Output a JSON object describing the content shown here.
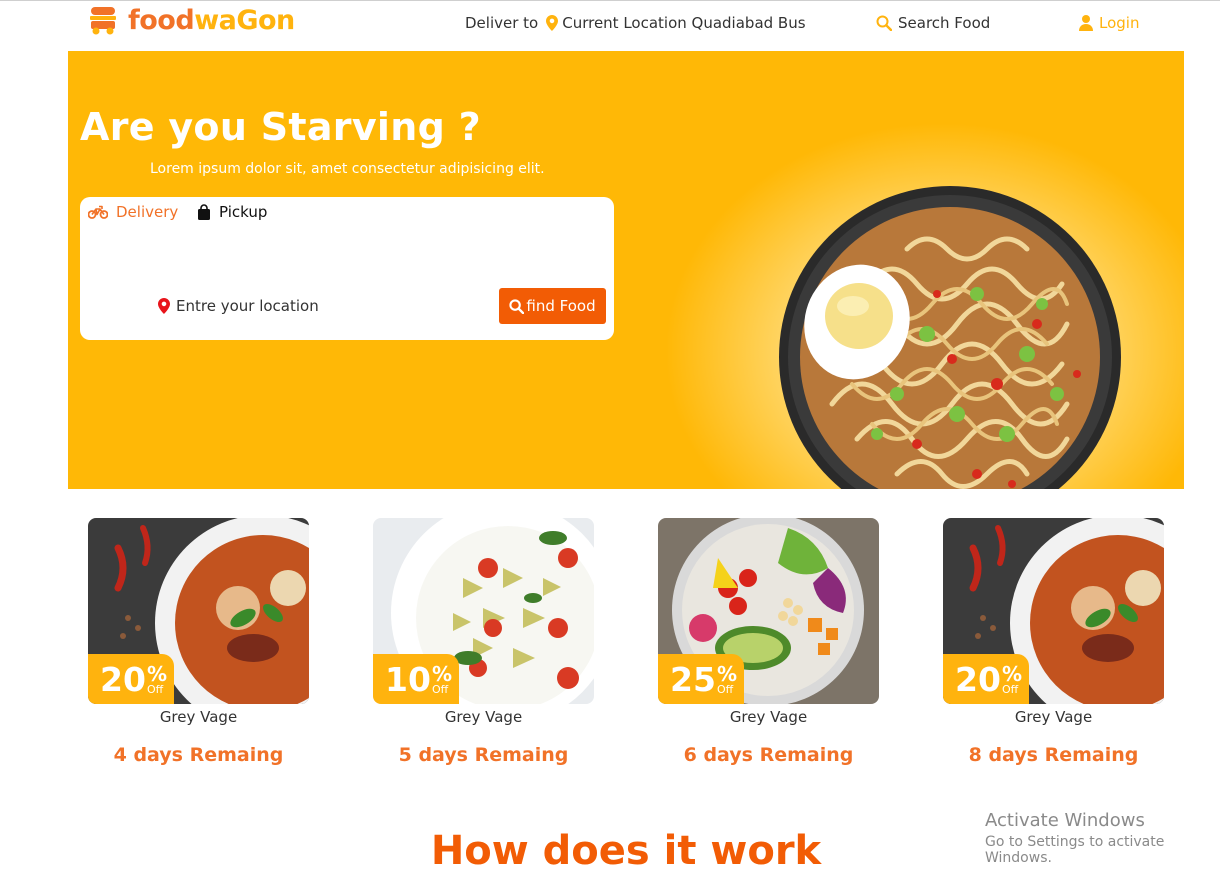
{
  "brand": {
    "name_part1": "food",
    "name_part2": "waGon",
    "icon": "food-truck-icon"
  },
  "header": {
    "deliver_label": "Deliver to",
    "location_text": "Current Location Quadiabad Bus",
    "search_label": "Search Food",
    "login_label": "Login"
  },
  "hero": {
    "title": "Are you Starving ?",
    "subtitle": "Lorem ipsum dolor sit, amet consectetur adipisicing elit.",
    "tabs": [
      {
        "label": "Delivery",
        "icon": "motorbike-icon",
        "active": true
      },
      {
        "label": "Pickup",
        "icon": "bag-icon",
        "active": false
      }
    ],
    "location_placeholder": "Entre your location",
    "find_button": "find Food"
  },
  "offers": [
    {
      "discount": "20",
      "pct": "%",
      "off": "Off",
      "name": "Grey Vage",
      "days": "4 days Remaing",
      "image": "curry"
    },
    {
      "discount": "10",
      "pct": "%",
      "off": "Off",
      "name": "Grey Vage",
      "days": "5 days Remaing",
      "image": "pasta"
    },
    {
      "discount": "25",
      "pct": "%",
      "off": "Off",
      "name": "Grey Vage",
      "days": "6 days Remaing",
      "image": "salad"
    },
    {
      "discount": "20",
      "pct": "%",
      "off": "Off",
      "name": "Grey Vage",
      "days": "8 days Remaing",
      "image": "curry"
    }
  ],
  "how_title": "How does it work",
  "watermark": {
    "line1": "Activate Windows",
    "line2": "Go to Settings to activate Windows."
  },
  "colors": {
    "brand_orange": "#f17228",
    "brand_yellow": "#ffb30e",
    "button": "#f25c05",
    "hero_bg": "#ffb806"
  }
}
